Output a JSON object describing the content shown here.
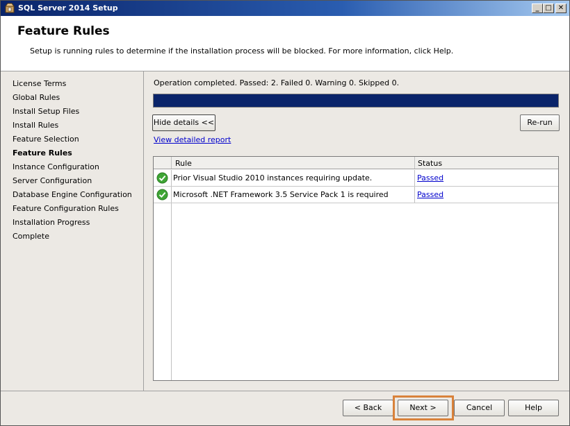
{
  "window": {
    "title": "SQL Server 2014 Setup",
    "controls": {
      "minimize": "_",
      "maximize": "□",
      "close": "✕"
    }
  },
  "header": {
    "title": "Feature Rules",
    "description": "Setup is running rules to determine if the installation process will be blocked. For more information, click Help."
  },
  "sidebar": {
    "items": [
      {
        "label": "License Terms",
        "active": false
      },
      {
        "label": "Global Rules",
        "active": false
      },
      {
        "label": "Install Setup Files",
        "active": false
      },
      {
        "label": "Install Rules",
        "active": false
      },
      {
        "label": "Feature Selection",
        "active": false
      },
      {
        "label": "Feature Rules",
        "active": true
      },
      {
        "label": "Instance Configuration",
        "active": false
      },
      {
        "label": "Server Configuration",
        "active": false
      },
      {
        "label": "Database Engine Configuration",
        "active": false
      },
      {
        "label": "Feature Configuration Rules",
        "active": false
      },
      {
        "label": "Installation Progress",
        "active": false
      },
      {
        "label": "Complete",
        "active": false
      }
    ]
  },
  "main": {
    "status": "Operation completed. Passed: 2.   Failed 0.   Warning 0.   Skipped 0.",
    "progress_percent": 100,
    "hide_details_label": "Hide details <<",
    "rerun_label": "Re-run",
    "report_link": "View detailed report",
    "grid": {
      "columns": [
        "Rule",
        "Status"
      ],
      "rows": [
        {
          "icon": "check-circle-icon",
          "rule": "Prior Visual Studio 2010 instances requiring update.",
          "status": "Passed"
        },
        {
          "icon": "check-circle-icon",
          "rule": "Microsoft .NET Framework 3.5 Service Pack 1 is required",
          "status": "Passed"
        }
      ]
    }
  },
  "footer": {
    "back_label": "< Back",
    "next_label": "Next >",
    "cancel_label": "Cancel",
    "help_label": "Help"
  },
  "colors": {
    "progress_fill": "#0a246a",
    "link": "#0000cc",
    "focus_highlight": "#d9823b",
    "pass_green": "#3fa535"
  }
}
